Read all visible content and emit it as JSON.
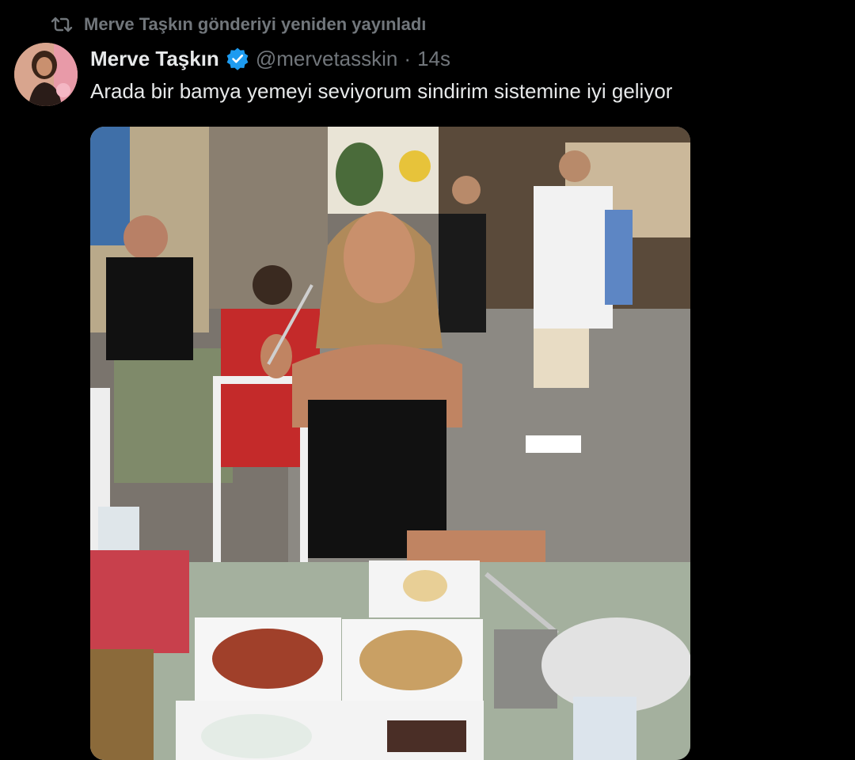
{
  "repost": {
    "icon": "repost-icon",
    "text": "Merve Taşkın gönderiyi yeniden yayınladı"
  },
  "author": {
    "display_name": "Merve Taşkın",
    "verified_icon": "verified-badge-icon",
    "handle": "@mervetasskin",
    "separator": "·",
    "time": "14s"
  },
  "tweet": {
    "text": "Arada bir bamya yemeyi seviyorum sindirim sistemine iyi geliyor"
  },
  "colors": {
    "background": "#000000",
    "primary_text": "#e7e9ea",
    "secondary_text": "#71767b",
    "verified_blue": "#1d9bf0"
  }
}
